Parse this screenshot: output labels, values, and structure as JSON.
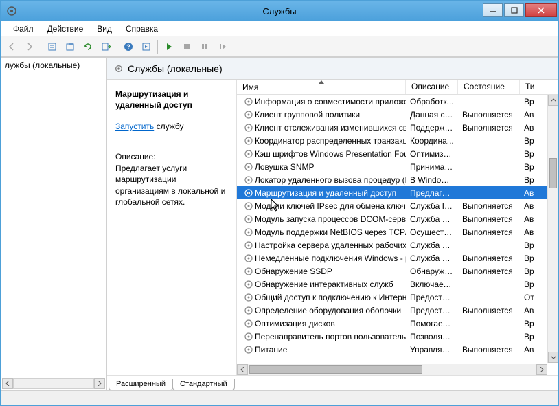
{
  "window": {
    "title": "Службы"
  },
  "menubar": [
    "Файл",
    "Действие",
    "Вид",
    "Справка"
  ],
  "leftPane": {
    "item": "лужбы (локальные)"
  },
  "paneHeader": "Службы (локальные)",
  "detail": {
    "title": "Маршрутизация и удаленный доступ",
    "linkText": "Запустить",
    "linkSuffix": " службу",
    "descLabel": "Описание:",
    "desc": "Предлагает услуги маршрутизации организациям в локальной и глобальной сетях."
  },
  "columns": {
    "name": "Имя",
    "desc": "Описание",
    "state": "Состояние",
    "type": "Ти"
  },
  "services": [
    {
      "name": "Информация о совместимости приложе...",
      "desc": "Обработк...",
      "state": "",
      "type": "Вр"
    },
    {
      "name": "Клиент групповой политики",
      "desc": "Данная сл...",
      "state": "Выполняется",
      "type": "Ав"
    },
    {
      "name": "Клиент отслеживания изменившихся свя...",
      "desc": "Поддержи...",
      "state": "Выполняется",
      "type": "Ав"
    },
    {
      "name": "Координатор распределенных транзакций",
      "desc": "Координа...",
      "state": "",
      "type": "Вр"
    },
    {
      "name": "Кэш шрифтов Windows Presentation Foun...",
      "desc": "Оптимизи...",
      "state": "",
      "type": "Вр"
    },
    {
      "name": "Ловушка SNMP",
      "desc": "Принимае...",
      "state": "",
      "type": "Вр"
    },
    {
      "name": "Локатор удаленного вызова процедур (R...",
      "desc": "В Windows...",
      "state": "",
      "type": "Вр"
    },
    {
      "name": "Маршрутизация и удаленный доступ",
      "desc": "Предлагае...",
      "state": "",
      "type": "Ав",
      "selected": true
    },
    {
      "name": "Модули ключей IPsec для обмена ключа...",
      "desc": "Служба IK...",
      "state": "Выполняется",
      "type": "Ав"
    },
    {
      "name": "Модуль запуска процессов DCOM-сервера",
      "desc": "Служба D...",
      "state": "Выполняется",
      "type": "Ав"
    },
    {
      "name": "Модуль поддержки NetBIOS через TCP/IP",
      "desc": "Осуществ...",
      "state": "Выполняется",
      "type": "Ав"
    },
    {
      "name": "Настройка сервера удаленных рабочих с...",
      "desc": "Служба на...",
      "state": "",
      "type": "Вр"
    },
    {
      "name": "Немедленные подключения Windows - р...",
      "desc": "Служба W...",
      "state": "Выполняется",
      "type": "Вр"
    },
    {
      "name": "Обнаружение SSDP",
      "desc": "Обнаружи...",
      "state": "Выполняется",
      "type": "Вр"
    },
    {
      "name": "Обнаружение интерактивных служб",
      "desc": "Включает ...",
      "state": "",
      "type": "Вр"
    },
    {
      "name": "Общий доступ к подключению к Интерн...",
      "desc": "Предостав...",
      "state": "",
      "type": "От"
    },
    {
      "name": "Определение оборудования оболочки",
      "desc": "Предостав...",
      "state": "Выполняется",
      "type": "Ав"
    },
    {
      "name": "Оптимизация дисков",
      "desc": "Помогает ...",
      "state": "",
      "type": "Вр"
    },
    {
      "name": "Перенаправитель портов пользовательск...",
      "desc": "Позволяет...",
      "state": "",
      "type": "Вр"
    },
    {
      "name": "Питание",
      "desc": "Управляет...",
      "state": "Выполняется",
      "type": "Ав"
    }
  ],
  "tabs": {
    "extended": "Расширенный",
    "standard": "Стандартный"
  }
}
